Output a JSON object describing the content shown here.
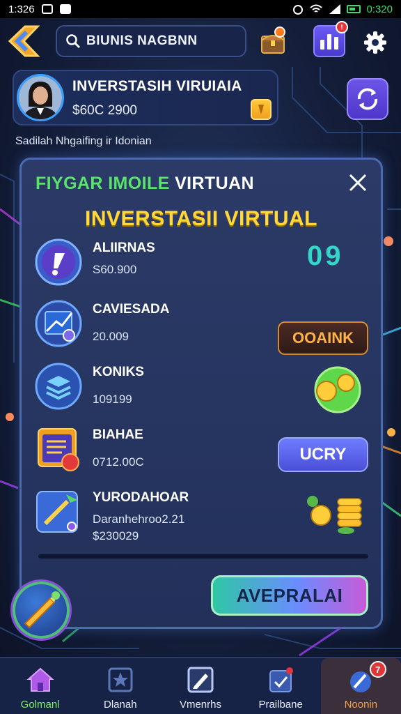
{
  "status_bar": {
    "time": "1:326",
    "right_time": "0:320"
  },
  "top_bar": {
    "search_label": "BIUNIS NAGBNN",
    "stats_badge": "!"
  },
  "profile": {
    "name": "INVERSTASIH VIRUIAIA",
    "balance": "$60C 2900"
  },
  "subtitle": "Sadilah Nhgaifing ir Idonian",
  "modal": {
    "header_green": "FIYGAR IMOILE",
    "header_white": "VIRTUAN",
    "title": "INVERSTASII VIRTUAL",
    "items": [
      {
        "name": "ALIIRNAS",
        "value": "S60.900",
        "side_text": "09"
      },
      {
        "name": "CAVIESADA",
        "value": "20.009",
        "action_label": "OOAINK"
      },
      {
        "name": "KONIKS",
        "value": "109199"
      },
      {
        "name": "BIAHAE",
        "value": "0712.00C",
        "action_label": "UCRY"
      },
      {
        "name": "YURODAHOAR",
        "value": "Daranhehroo2.21",
        "value2": "$230029"
      }
    ],
    "cta_label": "AVEPRALAI"
  },
  "bottom_nav": [
    {
      "label": "Golmanl",
      "active": true
    },
    {
      "label": "Dlanah",
      "active": false
    },
    {
      "label": "Vmenrhs",
      "active": false
    },
    {
      "label": "Prailbane",
      "active": false
    },
    {
      "label": "Noonin",
      "active": false,
      "badge": "7"
    }
  ],
  "colors": {
    "accent_yellow": "#ffd83a",
    "accent_green": "#59e36b",
    "primary_blue": "#4a4fd8",
    "background": "#141e3a"
  }
}
